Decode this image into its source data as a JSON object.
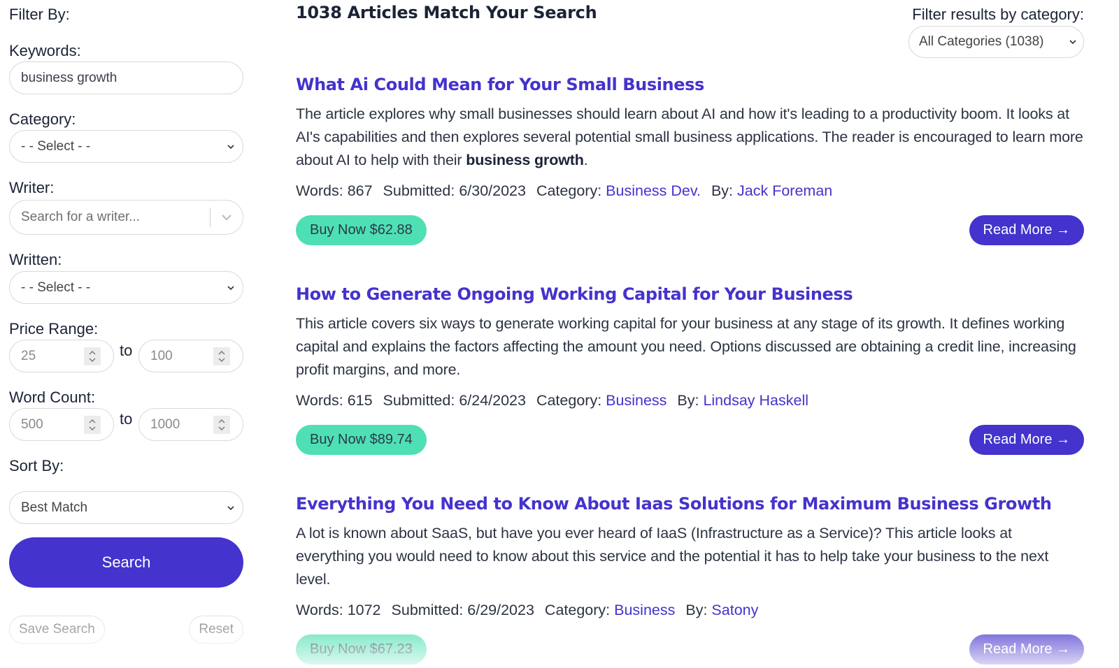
{
  "sidebar": {
    "heading": "Filter By:",
    "keywords": {
      "label": "Keywords:",
      "value": "business growth"
    },
    "category": {
      "label": "Category:",
      "selected": "- - Select - -"
    },
    "writer": {
      "label": "Writer:",
      "placeholder": "Search for a writer..."
    },
    "written": {
      "label": "Written:",
      "selected": "- - Select - -"
    },
    "price_range": {
      "label": "Price Range:",
      "min": "25",
      "max": "100",
      "to_label": "to"
    },
    "word_count": {
      "label": "Word Count:",
      "min": "500",
      "max": "1000",
      "to_label": "to"
    },
    "sort_by": {
      "label": "Sort By:",
      "selected": "Best Match"
    },
    "search_button": "Search",
    "save_search_button": "Save Search",
    "reset_button": "Reset"
  },
  "main": {
    "results_title": "1038 Articles Match Your Search",
    "category_filter": {
      "label": "Filter results by category:",
      "selected": "All Categories (1038)"
    },
    "meta_labels": {
      "words": "Words:",
      "submitted": "Submitted:",
      "category": "Category:",
      "by": "By:"
    },
    "articles": [
      {
        "title": "What Ai Could Mean for Your Small Business",
        "summary_before": "The article explores why small businesses should learn about AI and how it's leading to a productivity boom. It looks at AI's capabilities and then explores several potential small business applications. The reader is encouraged to learn more about AI to help with their ",
        "summary_highlight": "business growth",
        "summary_after": ".",
        "words": "867",
        "submitted": "6/30/2023",
        "category": "Business Dev.",
        "author": "Jack Foreman",
        "buy_label": "Buy Now $62.88",
        "read_label": "Read More →"
      },
      {
        "title": "How to Generate Ongoing Working Capital for Your Business",
        "summary_before": "This article covers six ways to generate working capital for your business at any stage of its growth. It defines working capital and explains the factors affecting the amount you need. Options discussed are obtaining a credit line, increasing profit margins, and more.",
        "summary_highlight": "",
        "summary_after": "",
        "words": "615",
        "submitted": "6/24/2023",
        "category": "Business",
        "author": "Lindsay Haskell",
        "buy_label": "Buy Now $89.74",
        "read_label": "Read More →"
      },
      {
        "title": "Everything You Need to Know About Iaas Solutions for Maximum Business Growth",
        "summary_before": "A lot is known about SaaS, but have you ever heard of IaaS (Infrastructure as a Service)? This article looks at everything you would need to know about this service and the potential it has to help take your business to the next level.",
        "summary_highlight": "",
        "summary_after": "",
        "words": "1072",
        "submitted": "6/29/2023",
        "category": "Business",
        "author": "Satony",
        "buy_label": "Buy Now $67.23",
        "read_label": "Read More →"
      }
    ]
  },
  "colors": {
    "accent": "#4433cc",
    "buy": "#4ee0b4",
    "text": "#1b2336"
  },
  "icons": {
    "select_caret": "chevron-down-icon",
    "stepper": "up-down-stepper-icon",
    "arrow": "arrow-right-icon"
  }
}
